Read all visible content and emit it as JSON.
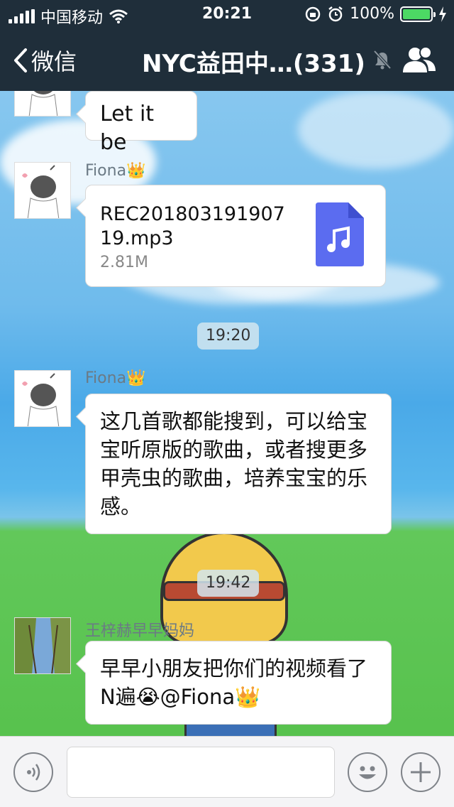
{
  "status_bar": {
    "carrier": "中国移动",
    "time": "20:21",
    "battery": "100%"
  },
  "nav": {
    "back_label": "微信",
    "title": "NYC益田中…(331)"
  },
  "messages": [
    {
      "type": "text",
      "text": "Let it be"
    },
    {
      "type": "file",
      "sender": "Fiona",
      "sender_badge": "👑",
      "file_name": "REC20180319190719.mp3",
      "file_size": "2.81M"
    },
    {
      "type": "time",
      "text": "19:20"
    },
    {
      "type": "text",
      "sender": "Fiona",
      "sender_badge": "👑",
      "text": "这几首歌都能搜到，可以给宝宝听原版的歌曲，或者搜更多甲壳虫的歌曲，培养宝宝的乐感。"
    },
    {
      "type": "time",
      "text": "19:42"
    },
    {
      "type": "text",
      "sender": "王梓赫早早妈妈",
      "text": "早早小朋友把你们的视频看了N遍😭@Fiona👑"
    }
  ],
  "colors": {
    "header_bg": "#1f2e3a",
    "file_icon": "#5b6cf0",
    "battery_fill": "#4cd964"
  },
  "icons": [
    "signal-icon",
    "wifi-icon",
    "lock-rotation-icon",
    "alarm-icon",
    "battery-icon",
    "back-chevron-icon",
    "mute-bell-icon",
    "group-members-icon",
    "music-file-icon",
    "voice-icon",
    "emoji-icon",
    "plus-icon"
  ]
}
